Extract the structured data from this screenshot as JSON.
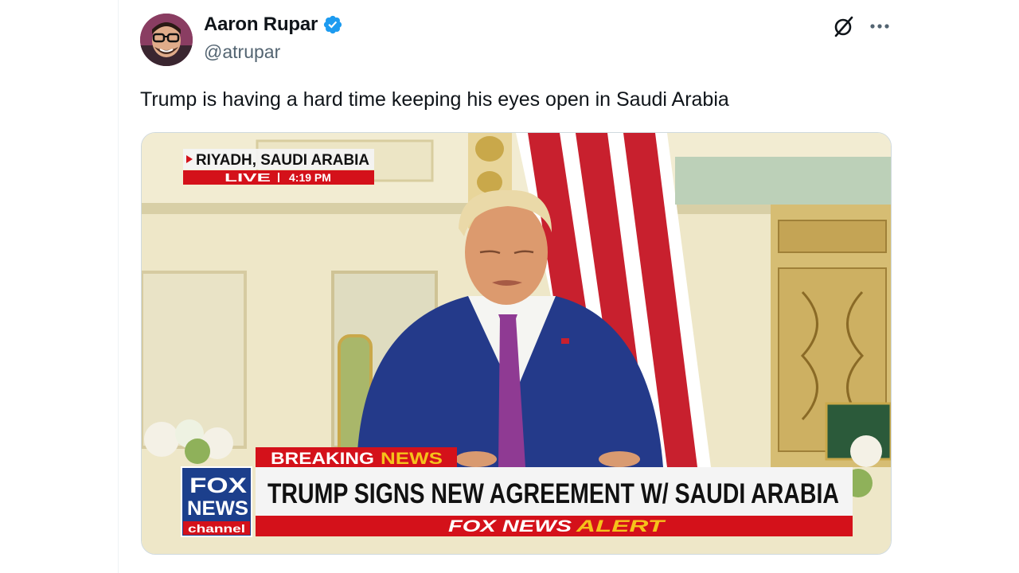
{
  "tweet": {
    "author_name": "Aaron Rupar",
    "handle": "@atrupar",
    "text": "Trump is having a hard time keeping his eyes open in Saudi Arabia",
    "verified": true,
    "icons": {
      "grok": "grok-slash-icon",
      "more": "more-dots-icon",
      "verified": "verified-badge-icon"
    }
  },
  "video": {
    "location": "RIYADH, SAUDI ARABIA",
    "live_label": "LIVE",
    "time": "4:19 PM",
    "breaking_label_1": "BREAKING",
    "breaking_label_2": "NEWS",
    "headline": "TRUMP SIGNS NEW AGREEMENT W/ SAUDI ARABIA",
    "alert_label_1": "FOX NEWS",
    "alert_label_2": "ALERT",
    "logo_line1": "FOX",
    "logo_line2": "NEWS",
    "logo_line3": "channel"
  },
  "colors": {
    "verified": "#1d9bf0",
    "fox_red": "#d4111a",
    "fox_blue": "#1c3f8c",
    "alert_yellow": "#f5c21a"
  }
}
